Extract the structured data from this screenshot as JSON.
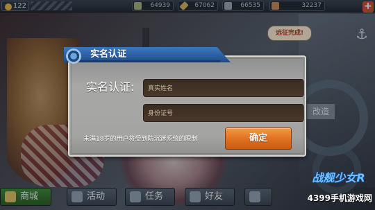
{
  "topbar": {
    "level": "122",
    "resources": {
      "fuel": "64939",
      "ammo": "67062",
      "steel": "66535",
      "bauxite": "32237"
    },
    "plus_label": "+"
  },
  "background": {
    "speech_bubble": "远征完成!",
    "chip_label": "改造"
  },
  "dialog": {
    "title": "实名认证",
    "field_label": "实名认证:",
    "name_placeholder": "真实姓名",
    "id_placeholder": "身份证号",
    "notice": "未满18岁的用户将受到防沉迷系统的限制",
    "confirm_label": "确定"
  },
  "bottom_nav": {
    "shop": "商城",
    "activity": "活动",
    "task": "任务",
    "friends": "好友"
  },
  "watermark": {
    "logo": "战舰少女R",
    "site": "4399手机游戏网"
  }
}
